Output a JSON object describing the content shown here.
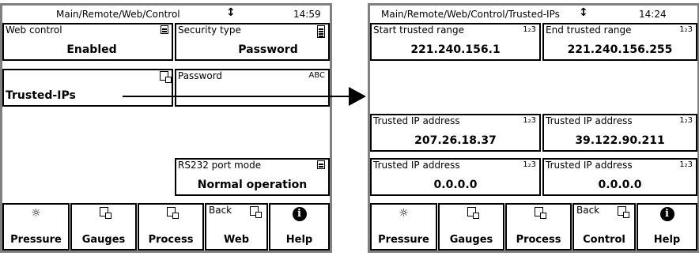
{
  "left": {
    "header": {
      "path": "Main/Remote/Web/Control",
      "arrow": "↕",
      "time": "14:59"
    },
    "web_control": {
      "label": "Web control",
      "value": "Enabled"
    },
    "security_type": {
      "label": "Security type",
      "value": "Password"
    },
    "trusted_ips": {
      "value": "Trusted-IPs"
    },
    "password": {
      "label": "Password",
      "icon_text": "ABC"
    },
    "rs232": {
      "label": "RS232 port mode",
      "value": "Normal operation"
    },
    "buttons": [
      {
        "label": "Pressure",
        "icon": "gauge-light-icon"
      },
      {
        "label": "Gauges",
        "icon": "gauges-icon"
      },
      {
        "label": "Process",
        "icon": "process-icon"
      },
      {
        "top": "Back",
        "label": "Web",
        "icon": "back-icon"
      },
      {
        "label": "Help",
        "icon": "info-icon"
      }
    ]
  },
  "right": {
    "header": {
      "path": "Main/Remote/Web/Control/Trusted-IPs",
      "arrow": "↕",
      "time": "14:24"
    },
    "numeric_icon": "1₂3",
    "fields": [
      {
        "label": "Start trusted range",
        "value": "221.240.156.1"
      },
      {
        "label": "End trusted range",
        "value": "221.240.156.255"
      },
      {
        "label": "Trusted IP address",
        "value": "207.26.18.37"
      },
      {
        "label": "Trusted IP address",
        "value": "39.122.90.211"
      },
      {
        "label": "Trusted IP address",
        "value": "0.0.0.0"
      },
      {
        "label": "Trusted IP address",
        "value": "0.0.0.0"
      }
    ],
    "buttons": [
      {
        "label": "Pressure",
        "icon": "gauge-light-icon"
      },
      {
        "label": "Gauges",
        "icon": "gauges-icon"
      },
      {
        "label": "Process",
        "icon": "process-icon"
      },
      {
        "top": "Back",
        "label": "Control",
        "icon": "back-icon"
      },
      {
        "label": "Help",
        "icon": "info-icon"
      }
    ]
  }
}
